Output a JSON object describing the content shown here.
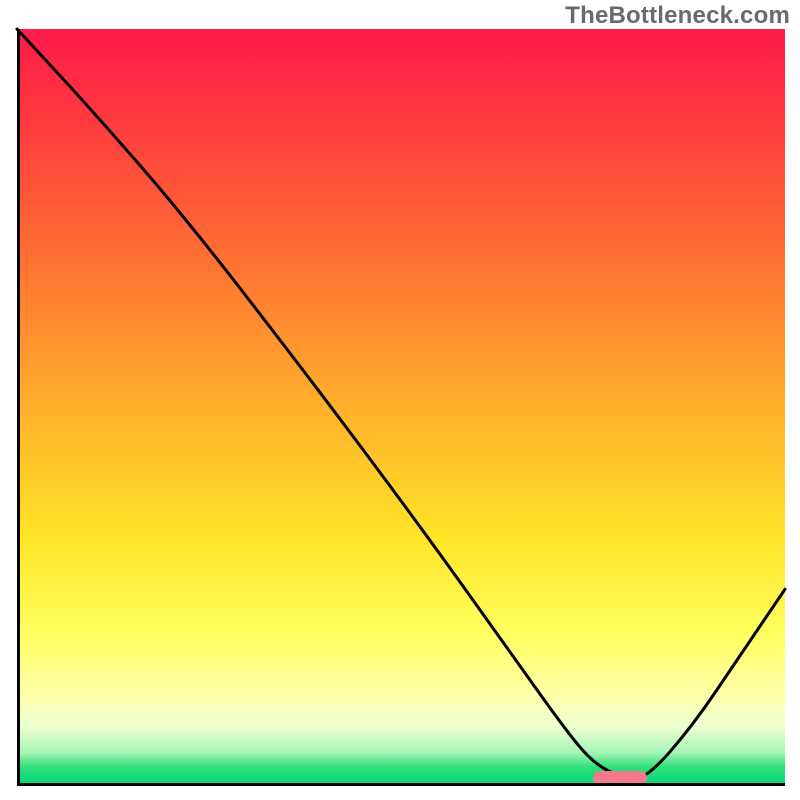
{
  "watermark": "TheBottleneck.com",
  "chart_data": {
    "type": "line",
    "title": "",
    "xlabel": "",
    "ylabel": "",
    "xlim": [
      0,
      100
    ],
    "ylim": [
      0,
      100
    ],
    "gradient_colors": {
      "top": "#ff1a4b",
      "upper_mid": "#ff6f33",
      "mid": "#ffe427",
      "lower_mid": "#ffff80",
      "bottom": "#00d37a"
    },
    "series": [
      {
        "name": "bottleneck-curve",
        "x": [
          0,
          10,
          22,
          38,
          52,
          64,
          71,
          75,
          79,
          82,
          88,
          94,
          100
        ],
        "y": [
          100,
          89,
          75,
          54,
          35,
          18,
          8,
          3,
          1,
          1,
          8,
          17,
          26
        ]
      }
    ],
    "optimal_range_x": [
      75,
      82
    ],
    "optimal_y": 1,
    "marker_color": "#f27a8a",
    "axis_color": "#000000"
  }
}
